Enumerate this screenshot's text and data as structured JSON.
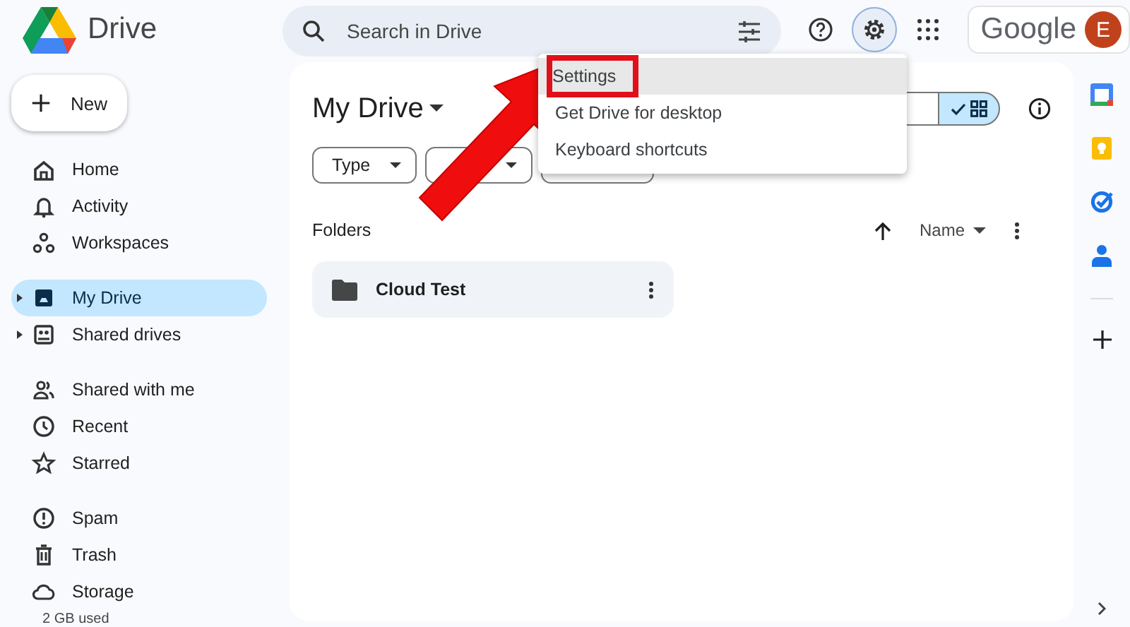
{
  "app": {
    "name": "Drive"
  },
  "search": {
    "placeholder": "Search in Drive"
  },
  "header": {
    "settings_selected": true,
    "brand": "Google",
    "avatar_initial": "E"
  },
  "new_button": {
    "label": "New"
  },
  "sidebar": {
    "groups": [
      [
        {
          "label": "Home",
          "selected": false,
          "expandable": false
        },
        {
          "label": "Activity",
          "selected": false,
          "expandable": false
        },
        {
          "label": "Workspaces",
          "selected": false,
          "expandable": false
        }
      ],
      [
        {
          "label": "My Drive",
          "selected": true,
          "expandable": true
        },
        {
          "label": "Shared drives",
          "selected": false,
          "expandable": true
        }
      ],
      [
        {
          "label": "Shared with me",
          "selected": false,
          "expandable": false
        },
        {
          "label": "Recent",
          "selected": false,
          "expandable": false
        },
        {
          "label": "Starred",
          "selected": false,
          "expandable": false
        }
      ],
      [
        {
          "label": "Spam",
          "selected": false,
          "expandable": false
        },
        {
          "label": "Trash",
          "selected": false,
          "expandable": false
        },
        {
          "label": "Storage",
          "selected": false,
          "expandable": false
        }
      ]
    ],
    "storage_usage": "2 GB used"
  },
  "main": {
    "title": "My Drive",
    "filters": [
      {
        "label": "Type"
      }
    ],
    "grid_view_selected": true,
    "section": "Folders",
    "sort": {
      "label": "Name"
    },
    "folders": [
      {
        "name": "Cloud Test"
      }
    ]
  },
  "menu": {
    "items": [
      {
        "label": "Settings",
        "selected": true,
        "highlighted": true
      },
      {
        "label": "Get Drive for desktop",
        "selected": false,
        "highlighted": false
      },
      {
        "label": "Keyboard shortcuts",
        "selected": false,
        "highlighted": false
      }
    ]
  }
}
